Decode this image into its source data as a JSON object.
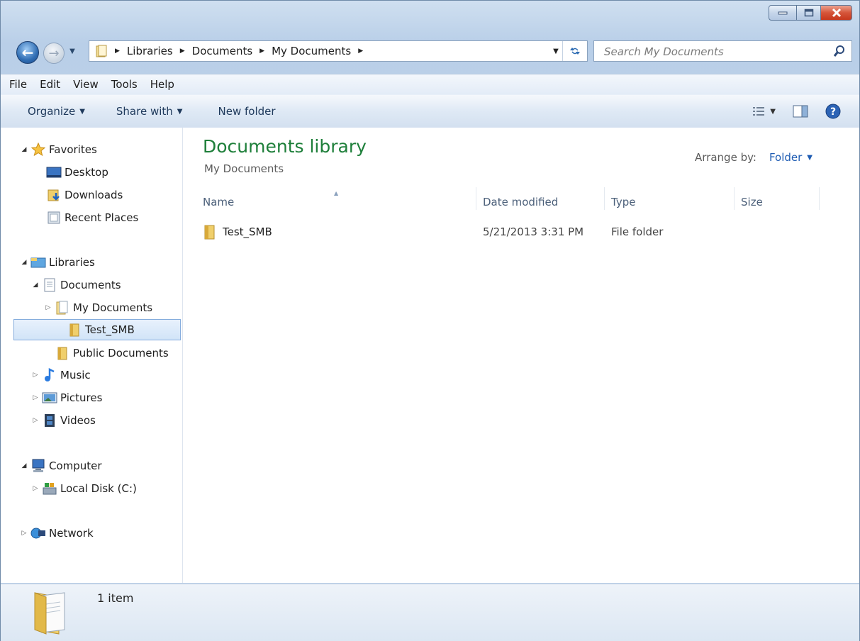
{
  "window": {
    "controls": {
      "minimize": "minimize",
      "maximize": "maximize",
      "close": "close"
    }
  },
  "address_bar": {
    "crumbs": [
      "Libraries",
      "Documents",
      "My Documents"
    ]
  },
  "search": {
    "placeholder": "Search My Documents"
  },
  "menu": [
    "File",
    "Edit",
    "View",
    "Tools",
    "Help"
  ],
  "toolbar": {
    "organize": "Organize",
    "share_with": "Share with",
    "new_folder": "New folder"
  },
  "nav_tree": {
    "favorites": "Favorites",
    "desktop": "Desktop",
    "downloads": "Downloads",
    "recent_places": "Recent Places",
    "libraries": "Libraries",
    "documents": "Documents",
    "my_documents": "My Documents",
    "test_smb": "Test_SMB",
    "public_documents": "Public Documents",
    "music": "Music",
    "pictures": "Pictures",
    "videos": "Videos",
    "computer": "Computer",
    "local_disk": "Local Disk (C:)",
    "network": "Network"
  },
  "content": {
    "title": "Documents library",
    "subtitle": "My Documents",
    "arrange_label": "Arrange by:",
    "arrange_value": "Folder",
    "columns": {
      "name": "Name",
      "date": "Date modified",
      "type": "Type",
      "size": "Size"
    },
    "files": [
      {
        "name": "Test_SMB",
        "date": "5/21/2013 3:31 PM",
        "type": "File folder",
        "size": ""
      }
    ]
  },
  "status": {
    "count": "1 item"
  },
  "colors": {
    "title_green": "#1e7f3a",
    "link_blue": "#1e5cb3"
  }
}
